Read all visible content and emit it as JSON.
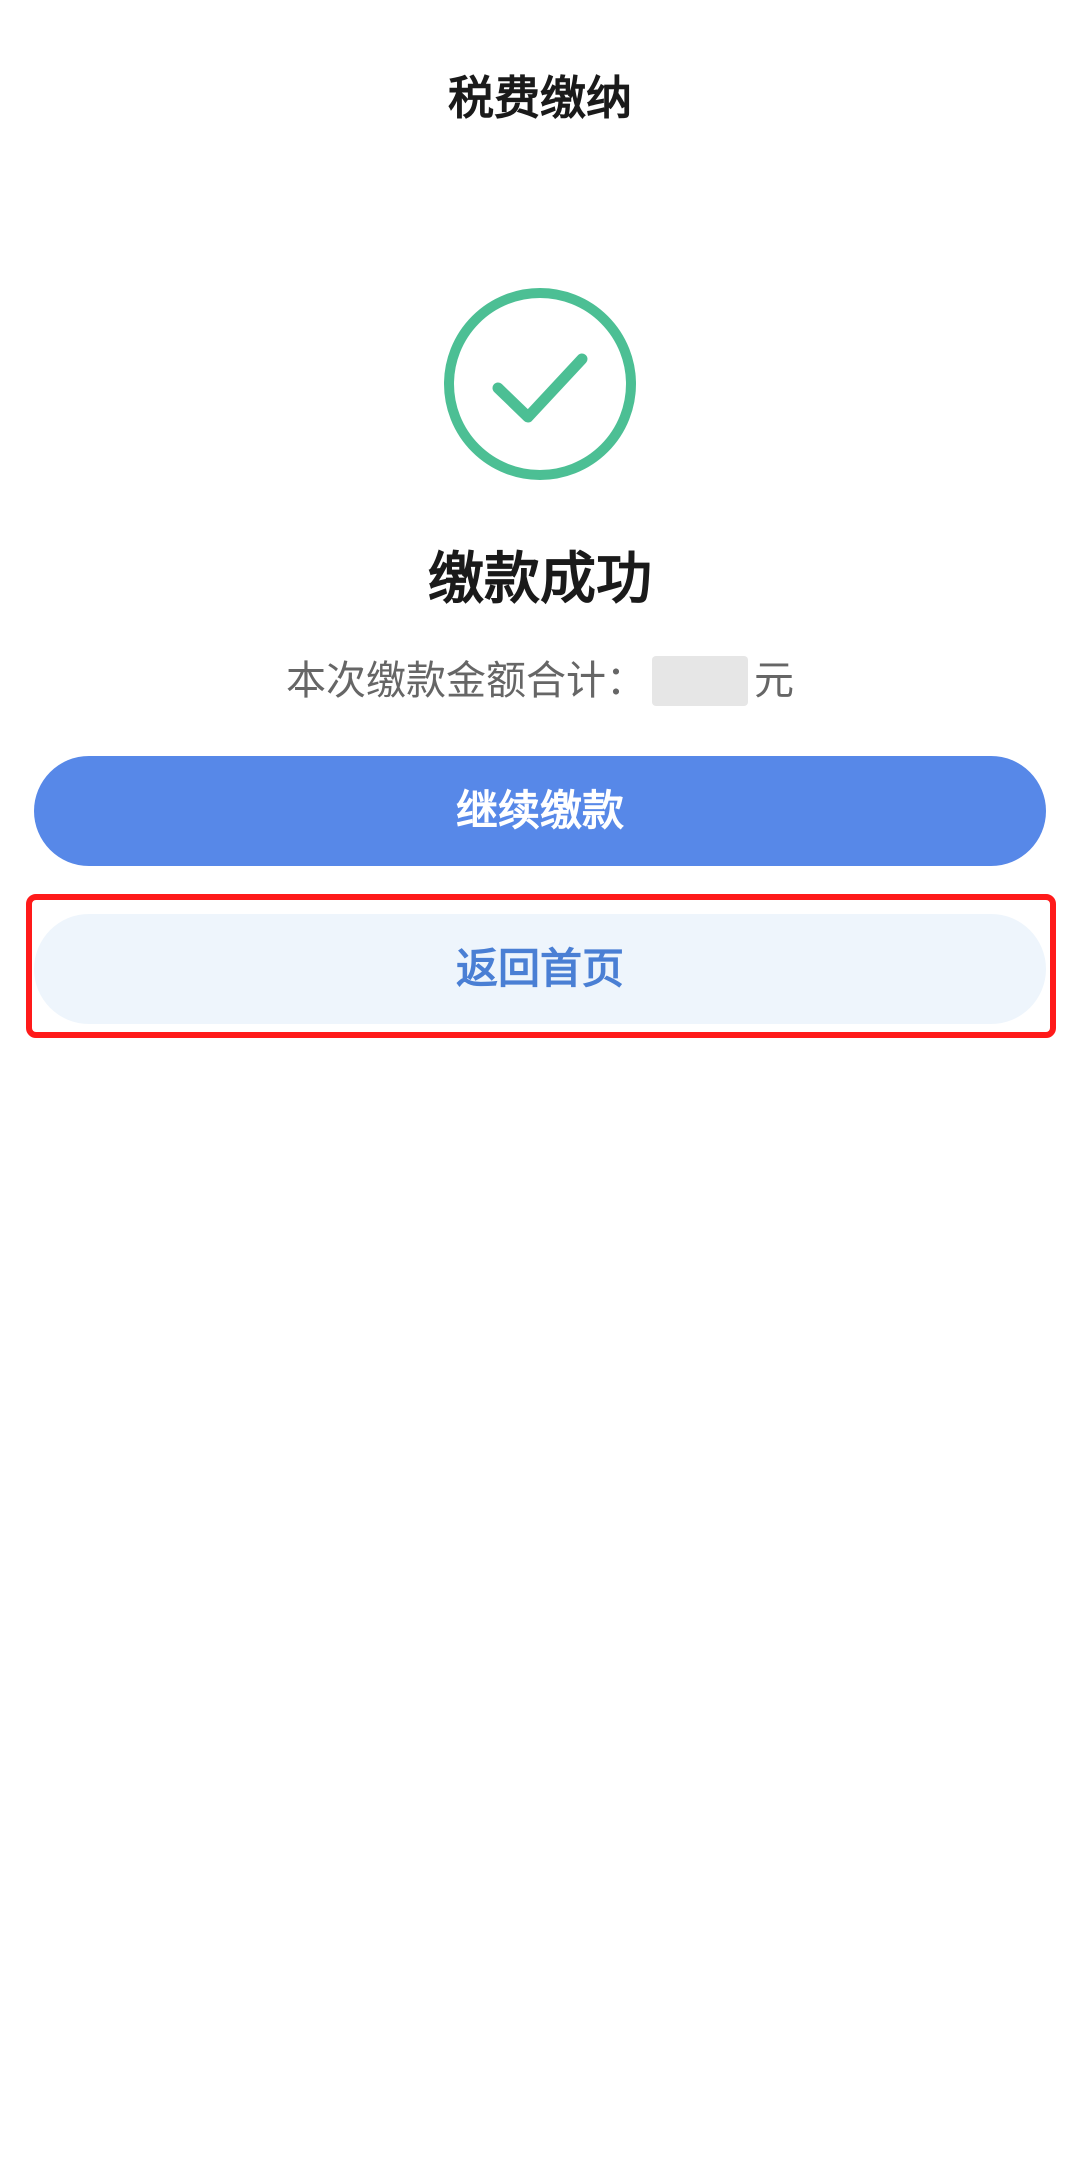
{
  "header": {
    "title": "税费缴纳"
  },
  "result": {
    "icon": "check-circle-icon",
    "icon_color": "#4cbf94",
    "title": "缴款成功",
    "amount_label": "本次缴款金额合计：",
    "amount_value": "",
    "amount_unit": "元"
  },
  "actions": {
    "continue_label": "继续缴款",
    "continue_color": "#5788e8",
    "home_label": "返回首页",
    "home_bg_color": "#eef5fc",
    "home_text_color": "#4a7fd4"
  },
  "annotation": {
    "highlight_color": "#ff1a1a"
  }
}
